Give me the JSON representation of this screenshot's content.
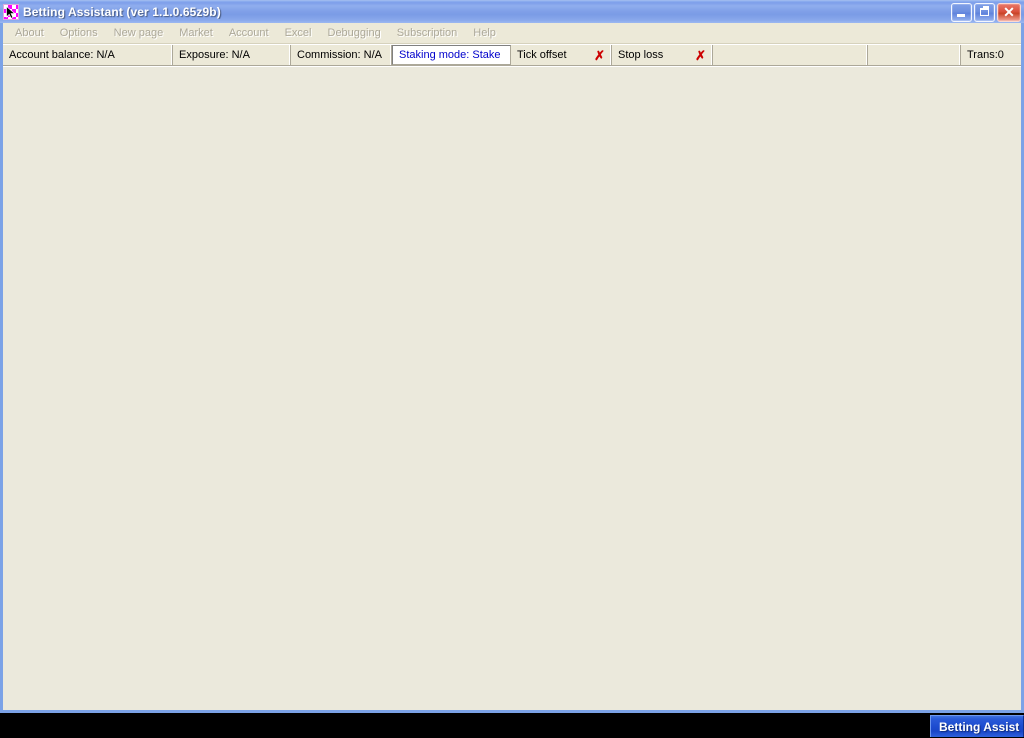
{
  "window": {
    "title": "Betting Assistant (ver 1.1.0.65z9b)",
    "icon": "app-checkered-cursor-icon",
    "controls": {
      "minimize": "Minimize",
      "restore": "Restore",
      "close": "Close",
      "close_glyph": "✕"
    },
    "accent_titlebar": "#7f9fe8",
    "client_bg": "#ebe9dc"
  },
  "menubar": {
    "items": [
      {
        "label": "About"
      },
      {
        "label": "Options"
      },
      {
        "label": "New page"
      },
      {
        "label": "Market"
      },
      {
        "label": "Account"
      },
      {
        "label": "Excel"
      },
      {
        "label": "Debugging"
      },
      {
        "label": "Subscription"
      },
      {
        "label": "Help"
      }
    ]
  },
  "statusbar": {
    "account_balance": "Account balance: N/A",
    "exposure": "Exposure: N/A",
    "commission": "Commission: N/A",
    "staking_mode": "Staking mode: Stake",
    "staking_mode_color": "#0000cc",
    "tick_offset": "Tick offset",
    "tick_offset_x": "✗",
    "stop_loss": "Stop loss",
    "stop_loss_x": "✗",
    "x_color": "#cc0000",
    "empty_panel_1": "",
    "empty_panel_2": "",
    "trans": "Trans:0"
  },
  "taskbar": {
    "button_label": "Betting Assist",
    "background": "#000000",
    "button_color": "#1d4cd0"
  }
}
